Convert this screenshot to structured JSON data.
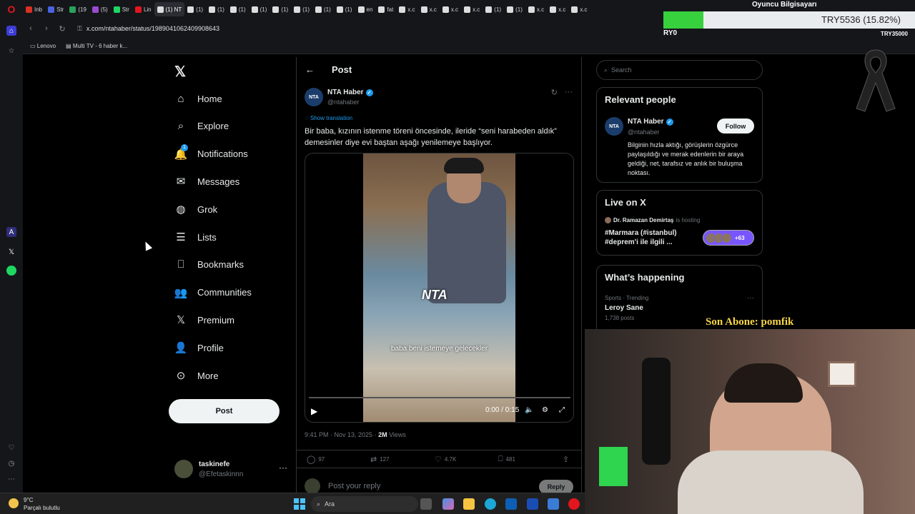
{
  "browser": {
    "tabs": [
      "Inb",
      "Str",
      "(19",
      "(5)",
      "Str",
      "Lin",
      "(1) NT",
      "(1)",
      "(1)",
      "(1)",
      "(1)",
      "(1)",
      "(1)",
      "(1)",
      "(1)",
      "en",
      "fat",
      "x.c",
      "x.c",
      "x.c",
      "x.c",
      "(1)",
      "(1)",
      "x.c",
      "x.c",
      "x.c"
    ],
    "url": "x.com/ntahaber/status/1989041062409908643",
    "bookmarks": [
      "Lenovo",
      "Multi TV - 6 haber k..."
    ]
  },
  "overlay": {
    "title": "Oyuncu Bilgisayarı",
    "donation_text": "TRY5536 (15.82%)",
    "donation_progress": 0.1582,
    "donation_min": "RY0",
    "donation_max": "TRY35000",
    "subscriber_label": "Son Abone: pomfik"
  },
  "nav": {
    "items": [
      {
        "label": "Home",
        "icon": "home-icon"
      },
      {
        "label": "Explore",
        "icon": "search-icon"
      },
      {
        "label": "Notifications",
        "icon": "bell-icon",
        "badge": "1"
      },
      {
        "label": "Messages",
        "icon": "mail-icon"
      },
      {
        "label": "Grok",
        "icon": "grok-icon"
      },
      {
        "label": "Lists",
        "icon": "list-icon"
      },
      {
        "label": "Bookmarks",
        "icon": "bookmark-icon"
      },
      {
        "label": "Communities",
        "icon": "people-icon"
      },
      {
        "label": "Premium",
        "icon": "x-icon"
      },
      {
        "label": "Profile",
        "icon": "person-icon"
      },
      {
        "label": "More",
        "icon": "more-circle-icon"
      }
    ],
    "post_button": "Post",
    "user": {
      "name": "taskinefe",
      "handle": "@Efetaskinnn"
    }
  },
  "post": {
    "header": "Post",
    "author_name": "NTA Haber",
    "author_handle": "@ntahaber",
    "avatar_text": "NTA",
    "show_translation": "Show translation",
    "text": "Bir baba, kızının istenme töreni öncesinde, ileride “seni harabeden aldık” demesinler diye evi baştan aşağı yenilemeye başlıyor.",
    "video_logo": "NTA",
    "video_caption": "baba beni istemeye gelecekler",
    "video_time": "0:00 / 0:15",
    "time": "9:41 PM · Nov 13, 2025 · ",
    "views": "2M",
    "views_label": " Views",
    "replies": "97",
    "reposts": "127",
    "likes": "4.7K",
    "bookmarks": "481",
    "reply_placeholder": "Post your reply",
    "reply_button": "Reply"
  },
  "right": {
    "search_placeholder": "Search",
    "relevant_title": "Relevant people",
    "rp_name": "NTA Haber",
    "rp_handle": "@ntahaber",
    "rp_follow": "Follow",
    "rp_bio": "Bilginin hızla aktığı, görüşlerin özgürce paylaşıldığı ve merak edenlerin bir araya geldiği, net, tarafsız ve anlık bir buluşma noktası.",
    "live_title": "Live on X",
    "live_host": "Dr. Ramazan Demirtaş",
    "live_hosting": "is hosting",
    "live_topic": "#Marmara (#istanbul) #deprem'i ile ilgili ...",
    "live_count": "+63",
    "happening_title": "What’s happening",
    "trend_sub": "Sports · Trending",
    "trend_name": "Leroy Sane",
    "trend_count": "1,738 posts"
  },
  "taskbar": {
    "temp": "9°C",
    "weather": "Parçalı bulutlu",
    "search": "Ara"
  }
}
